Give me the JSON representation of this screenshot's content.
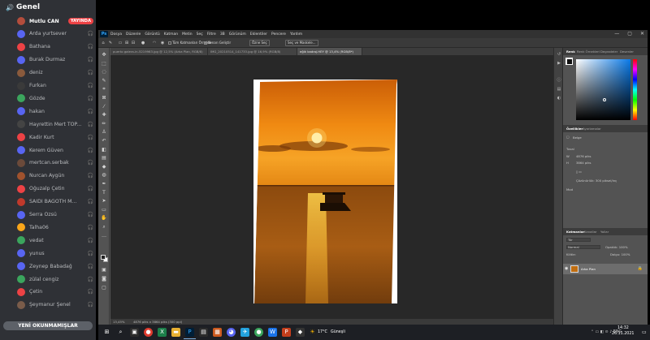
{
  "discord": {
    "channel_name": "Genel",
    "live_badge": "YAYINDA",
    "members": [
      {
        "name": "Mutlu CAN",
        "color": "#b44d3c",
        "live": true
      },
      {
        "name": "Arda yurtsever",
        "color": "#5865f2"
      },
      {
        "name": "Bathana",
        "color": "#ed4245"
      },
      {
        "name": "Burak Durmaz",
        "color": "#5865f2"
      },
      {
        "name": "deniz",
        "color": "#8a5a3c"
      },
      {
        "name": "Furkan",
        "color": "#3a3a3a"
      },
      {
        "name": "Gözde",
        "color": "#3ba55d"
      },
      {
        "name": "hakan",
        "color": "#5865f2"
      },
      {
        "name": "Hayrettin Mert TOP...",
        "color": "#444444"
      },
      {
        "name": "Kadir Kurt",
        "color": "#ed4245"
      },
      {
        "name": "Kerem Güven",
        "color": "#5865f2"
      },
      {
        "name": "mertcan.serbak",
        "color": "#6b4a3a"
      },
      {
        "name": "Nurcan Aygün",
        "color": "#a0522d"
      },
      {
        "name": "Oğuzalp Çetin",
        "color": "#ed4245"
      },
      {
        "name": "SAIDI BAGOTH M...",
        "color": "#c0392b"
      },
      {
        "name": "Serra Özsü",
        "color": "#5865f2"
      },
      {
        "name": "Talha06",
        "color": "#faa61a"
      },
      {
        "name": "vedat",
        "color": "#3ba55d"
      },
      {
        "name": "yunus",
        "color": "#5865f2"
      },
      {
        "name": "Zeynep Babadağ",
        "color": "#5865f2"
      },
      {
        "name": "zülal cengiz",
        "color": "#3ba55d"
      },
      {
        "name": "Çetin",
        "color": "#ed4245"
      },
      {
        "name": "Şeymanur Şenel",
        "color": "#7a5c4a"
      }
    ],
    "unread_label": "YENİ OKUNMAMIŞLAR"
  },
  "photoshop": {
    "logo": "Ps",
    "menu": [
      "Dosya",
      "Düzenle",
      "Görüntü",
      "Katman",
      "Metin",
      "Seç",
      "Filtre",
      "3B",
      "Görünüm",
      "Eklentiler",
      "Pencere",
      "Yardım"
    ],
    "window_controls": [
      "—",
      "▢",
      "✕"
    ],
    "options": {
      "sample_all_layers": "Tüm Katmanları Örnekle",
      "auto_enhance": "Kenarı Geliştir",
      "select_subject": "Özne Seç",
      "select_and_mask": "Seç ve Maskele..."
    },
    "tabs": [
      "puerto galera-in-5219963.jpg @ 12,5% (Arka Plan, RGB/8)",
      "IMG_20210514_141733.jpg @ 16,9% (RGB/8)",
      "eğik kadraj.HEY @ 13,4% (RGB/8*)"
    ],
    "status_zoom": "13,45%",
    "status_doc": "4876 piks x 3864 piks (300 ppi)",
    "panels": {
      "top_tabs": [
        "Renk",
        "Renk Örnekleri",
        "Degradeler",
        "Desenler"
      ],
      "props_tabs": [
        "Özellikler",
        "Ayarlamalar"
      ],
      "props_layer": "Belge",
      "canvas_label": "Tuval",
      "canvas_w": "4876 piks",
      "canvas_h": "3864 piks",
      "resolution": "Çözünürlük: 300 piksel/inç",
      "mode_label": "Mod",
      "layers_tabs": [
        "Katmanlar",
        "Kanallar",
        "Yollar"
      ],
      "layers_kind": "Tür",
      "layers_blend": "Normal",
      "layers_opacity": "Opaklık: 100%",
      "layers_fill": "Dolgu: 100%",
      "layers_lock": "Kilitle:",
      "layer_name": "Arka Plan"
    }
  },
  "taskbar": {
    "weather": "17°C",
    "weather_desc": "Güneşli",
    "time": "14:32",
    "date": "26.11.2021"
  }
}
